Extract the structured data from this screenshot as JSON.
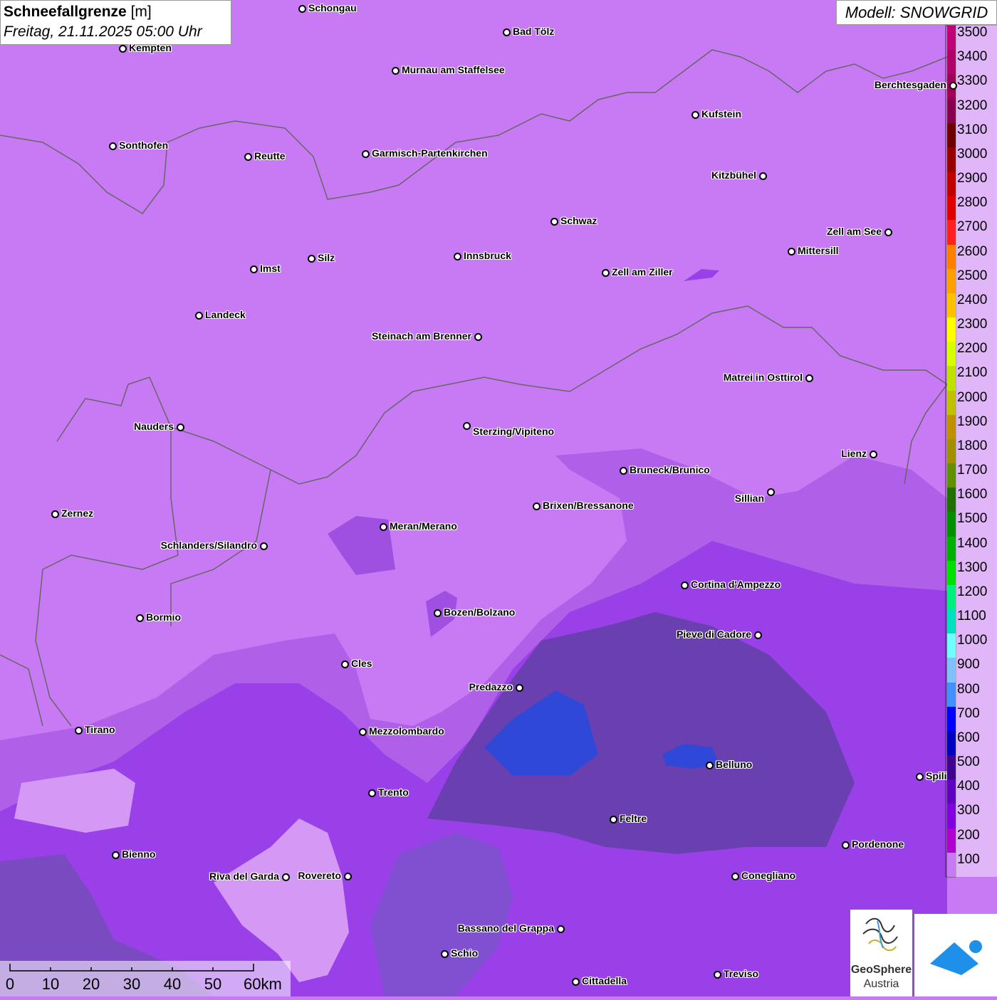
{
  "title": {
    "main": "Schneefallgrenze",
    "unit": "[m]",
    "datetime": "Freitag, 21.11.2025 05:00 Uhr"
  },
  "model": "Modell: SNOWGRID",
  "legend": {
    "levels": [
      "3500",
      "3400",
      "3300",
      "3200",
      "3100",
      "3000",
      "2900",
      "2800",
      "2700",
      "2600",
      "2500",
      "2400",
      "2300",
      "2200",
      "2100",
      "2000",
      "1900",
      "1800",
      "1700",
      "1600",
      "1500",
      "1400",
      "1300",
      "1200",
      "1100",
      "1000",
      "900",
      "800",
      "700",
      "600",
      "500",
      "400",
      "300",
      "200",
      "100"
    ],
    "colors": [
      "#c0007a",
      "#b0006a",
      "#a0005a",
      "#880050",
      "#700000",
      "#9a0000",
      "#c00000",
      "#e00000",
      "#ff2020",
      "#ff8000",
      "#ffa000",
      "#ffc000",
      "#ffff00",
      "#d8ff00",
      "#c0e000",
      "#c0c000",
      "#c09000",
      "#a09000",
      "#609000",
      "#207000",
      "#009000",
      "#00b000",
      "#00e000",
      "#00f080",
      "#00e0c0",
      "#70ffff",
      "#80c0ff",
      "#4090ff",
      "#0000ff",
      "#0000c0",
      "#400090",
      "#6000c0",
      "#8000e0",
      "#b000d0",
      "#c87af5"
    ]
  },
  "cities": [
    {
      "name": "Schongau"
    },
    {
      "name": "Kempten"
    },
    {
      "name": "Bad Tölz"
    },
    {
      "name": "Murnau am Staffelsee"
    },
    {
      "name": "Berchtesgaden"
    },
    {
      "name": "Kufstein"
    },
    {
      "name": "Sonthofen"
    },
    {
      "name": "Reutte"
    },
    {
      "name": "Garmisch-Partenkirchen"
    },
    {
      "name": "Kitzbühel"
    },
    {
      "name": "Schwaz"
    },
    {
      "name": "Zell am See"
    },
    {
      "name": "Innsbruck"
    },
    {
      "name": "Mittersill"
    },
    {
      "name": "Imst"
    },
    {
      "name": "Silz"
    },
    {
      "name": "Zell am Ziller"
    },
    {
      "name": "Landeck"
    },
    {
      "name": "Steinach am Brenner"
    },
    {
      "name": "Matrei in Osttirol"
    },
    {
      "name": "Nauders"
    },
    {
      "name": "Sterzing/Vipiteno"
    },
    {
      "name": "Lienz"
    },
    {
      "name": "Bruneck/Brunico"
    },
    {
      "name": "Sillian"
    },
    {
      "name": "Zernez"
    },
    {
      "name": "Brixen/Bressanone"
    },
    {
      "name": "Meran/Merano"
    },
    {
      "name": "Schlanders/Silandro"
    },
    {
      "name": "Cortina d'Ampezzo"
    },
    {
      "name": "Bormio"
    },
    {
      "name": "Bozen/Bolzano"
    },
    {
      "name": "Pieve di Cadore"
    },
    {
      "name": "Cles"
    },
    {
      "name": "Predazzo"
    },
    {
      "name": "Tirano"
    },
    {
      "name": "Mezzolombardo"
    },
    {
      "name": "Belluno"
    },
    {
      "name": "Spili"
    },
    {
      "name": "Trento"
    },
    {
      "name": "Feltre"
    },
    {
      "name": "Pordenone"
    },
    {
      "name": "Bienno"
    },
    {
      "name": "Riva del Garda"
    },
    {
      "name": "Rovereto"
    },
    {
      "name": "Conegliano"
    },
    {
      "name": "Bassano del Grappa"
    },
    {
      "name": "Schio"
    },
    {
      "name": "Treviso"
    },
    {
      "name": "Cittadella"
    }
  ],
  "scale_bar": {
    "ticks": [
      "0",
      "10",
      "20",
      "30",
      "40",
      "50",
      "60km"
    ]
  },
  "logo": {
    "name": "GeoSphere",
    "sub": "Austria"
  }
}
